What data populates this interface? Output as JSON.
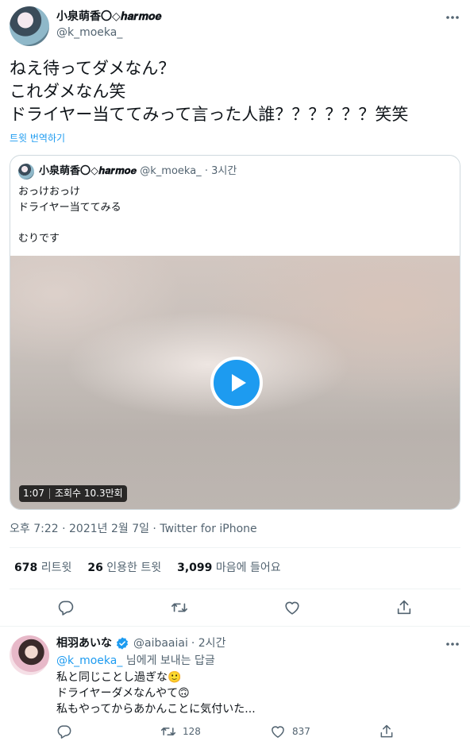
{
  "tweet": {
    "author_name": "小泉萌香〇◇𝒉𝒂𝒓𝒎𝒐𝒆",
    "author_handle": "@k_moeka_",
    "text_lines": [
      "ねえ待ってダメなん？",
      "これダメなん笑",
      "ドライヤー当ててみって言った人誰？？？？？？笑笑"
    ],
    "translate_label": "트윗 번역하기",
    "quote": {
      "author_name": "小泉萌香〇◇𝒉𝒂𝒓𝒎𝒐𝒆",
      "author_handle": "@k_moeka_",
      "time": "· 3시간",
      "text_lines": [
        "おっけおっけ",
        "ドライヤー当ててみる",
        "",
        "むりです"
      ],
      "video": {
        "duration": "1:07",
        "views": "조회수 10.3만회"
      }
    },
    "timestamp": "오후 7:22 · 2021년 2월 7일 · ",
    "source": "Twitter for iPhone",
    "stats": [
      {
        "value": "678",
        "label": "리트윗"
      },
      {
        "value": "26",
        "label": "인용한 트윗"
      },
      {
        "value": "3,099",
        "label": "마음에 들어요"
      }
    ]
  },
  "reply": {
    "author_name": "相羽あいな",
    "author_handle": "@aibaaiai",
    "time": "· 2시간",
    "replying_to_handle": "@k_moeka_",
    "replying_to_suffix": " 님에게 보내는 답글",
    "text_lines": [
      "私と同じことし過ぎな🙂",
      "ドライヤーダメなんやて🙃",
      "私もやってからあかんことに気付いた..."
    ],
    "retweet_count": "128",
    "like_count": "837"
  },
  "colors": {
    "accent": "#1d9bf0",
    "verified": "#1d9bf0",
    "text": "#0f1419",
    "secondary": "#536471"
  },
  "icons": [
    "more-icon",
    "reply-icon",
    "retweet-icon",
    "like-icon",
    "share-icon",
    "play-icon",
    "verified-icon"
  ]
}
